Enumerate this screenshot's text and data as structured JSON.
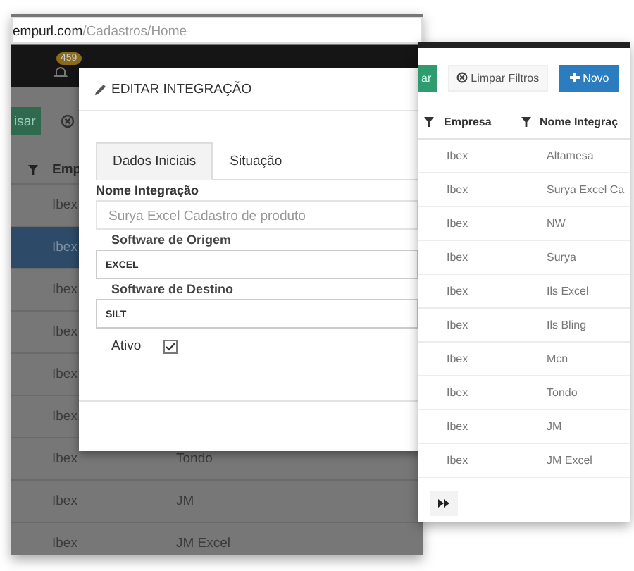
{
  "browser": {
    "url_domain": "empurl.com",
    "url_path": "/Cadastros/Home"
  },
  "navbar": {
    "notification_count": "459"
  },
  "background_page": {
    "button": "isar",
    "column": "Emp",
    "rows": [
      {
        "empresa": "Ibex",
        "selected": false
      },
      {
        "empresa": "Ibex",
        "selected": true
      },
      {
        "empresa": "Ibex",
        "selected": false
      },
      {
        "empresa": "Ibex",
        "selected": false
      },
      {
        "empresa": "Ibex",
        "selected": false
      },
      {
        "empresa": "Ibex",
        "selected": false
      },
      {
        "empresa": "Ibex",
        "nome": "Tondo",
        "selected": false
      },
      {
        "empresa": "Ibex",
        "nome": "JM",
        "selected": false
      },
      {
        "empresa": "Ibex",
        "nome": "JM Excel",
        "selected": false
      }
    ]
  },
  "modal": {
    "title": "EDITAR INTEGRAÇÃO",
    "tabs": [
      {
        "label": "Dados Iniciais",
        "selected": true
      },
      {
        "label": "Situação",
        "selected": false
      }
    ],
    "fields": [
      {
        "label": "Nome Integração",
        "value": "Surya Excel Cadastro de produto",
        "disabled": true
      },
      {
        "label": "Software de Origem",
        "value": "EXCEL",
        "disabled": false
      },
      {
        "label": "Software de Destino",
        "value": "SILT",
        "disabled": false
      }
    ],
    "checkbox": {
      "label": "Ativo",
      "checked": true
    }
  },
  "list_panel": {
    "buttons": [
      {
        "label": "ar",
        "kind": "success"
      },
      {
        "label": "Limpar Filtros",
        "kind": "clear"
      },
      {
        "label": "Novo",
        "kind": "new"
      }
    ],
    "columns": [
      "Empresa",
      "Nome Integraç"
    ],
    "rows": [
      {
        "empresa": "Ibex",
        "nome": "Altamesa"
      },
      {
        "empresa": "Ibex",
        "nome": "Surya Excel Ca"
      },
      {
        "empresa": "Ibex",
        "nome": "NW"
      },
      {
        "empresa": "Ibex",
        "nome": "Surya"
      },
      {
        "empresa": "Ibex",
        "nome": "Ils Excel"
      },
      {
        "empresa": "Ibex",
        "nome": "Ils Bling"
      },
      {
        "empresa": "Ibex",
        "nome": "Mcn"
      },
      {
        "empresa": "Ibex",
        "nome": "Tondo"
      },
      {
        "empresa": "Ibex",
        "nome": "JM"
      },
      {
        "empresa": "Ibex",
        "nome": "JM Excel"
      }
    ]
  }
}
